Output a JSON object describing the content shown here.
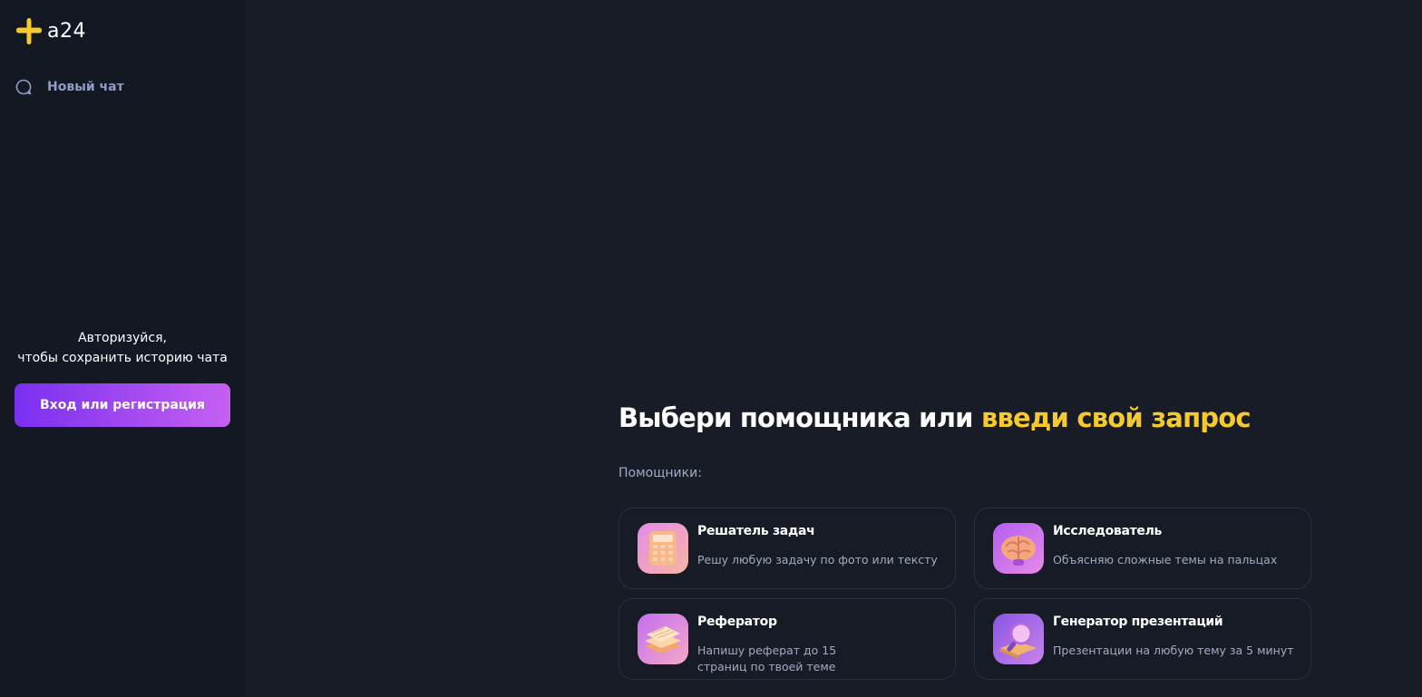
{
  "app": {
    "logo_text": "a24",
    "brand_colors": {
      "yellow": "#f6c92c",
      "purple_start": "#7a2ff0",
      "purple_end": "#c660f2"
    }
  },
  "sidebar": {
    "new_chat": {
      "label": "Новый чат",
      "icon": "chat-bubble-icon"
    },
    "auth_line1": "Авторизуйся,",
    "auth_line2": "чтобы сохранить историю чата",
    "login_button": "Вход или регистрация"
  },
  "main": {
    "heading_plain": "Выбери помощника или ",
    "heading_accent": "введи свой запрос",
    "assistants_label": "Помощники:",
    "assistants": [
      {
        "title": "Решатель задач",
        "desc": "Решу любую задачу по фото или тексту",
        "icon": "calculator-icon"
      },
      {
        "title": "Исследователь",
        "desc": "Объясняю сложные темы на пальцах",
        "icon": "brain-icon"
      },
      {
        "title": "Реферат​ор",
        "desc": "Напишу реферат до 15 страниц по твоей теме",
        "icon": "paper-stack-icon"
      },
      {
        "title": "Генератор презентаций",
        "desc": "Презентации на любую тему за 5 минут",
        "icon": "magnifier-book-icon"
      }
    ]
  }
}
